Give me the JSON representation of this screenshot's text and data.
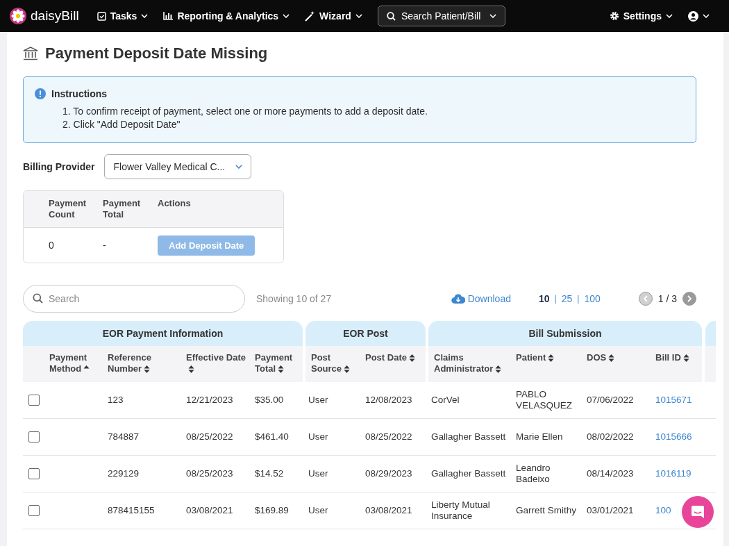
{
  "nav": {
    "brand": "daisyBill",
    "items": [
      {
        "label": "Tasks"
      },
      {
        "label": "Reporting & Analytics"
      },
      {
        "label": "Wizard"
      }
    ],
    "search": {
      "label": "Search Patient/Bill"
    },
    "settings": {
      "label": "Settings"
    }
  },
  "page": {
    "title": "Payment Deposit Date Missing"
  },
  "instructions": {
    "title": "Instructions",
    "steps": [
      "1. To confirm receipt of payment, select one or more payments to add a deposit date.",
      "2. Click \"Add Deposit Date\""
    ]
  },
  "billing_provider": {
    "label": "Billing Provider",
    "value": "Flower Valley Medical C..."
  },
  "summary": {
    "columns": [
      "Payment Count",
      "Payment Total",
      "Actions"
    ],
    "count": "0",
    "total": "-",
    "action": {
      "label": "Add Deposit Date",
      "disabled": true
    }
  },
  "toolbar": {
    "search": {
      "placeholder": "Search"
    },
    "showing": "Showing 10 of 27",
    "download": "Download",
    "page_sizes": [
      {
        "label": "10",
        "selected": true
      },
      {
        "label": "25",
        "selected": false
      },
      {
        "label": "100",
        "selected": false
      }
    ],
    "separators": [
      "|",
      "|"
    ],
    "page": "1 / 3",
    "prev_disabled": true,
    "next_disabled": false
  },
  "table": {
    "groups": [
      {
        "label": "EOR Payment Information"
      },
      {
        "label": "EOR Post"
      },
      {
        "label": "Bill Submission"
      }
    ],
    "columns": [
      {
        "label": "Payment Method",
        "sorted_ascending": true
      },
      {
        "label": "Reference Number",
        "sorted_ascending": false
      },
      {
        "label": "Effective Date",
        "sorted_ascending": false
      },
      {
        "label": "Payment Total",
        "sorted_ascending": false
      },
      {
        "label": "Post Source",
        "sorted_ascending": false
      },
      {
        "label": "Post Date",
        "sorted_ascending": false
      },
      {
        "label": "Claims Administrator",
        "sorted_ascending": false
      },
      {
        "label": "Patient",
        "sorted_ascending": false
      },
      {
        "label": "DOS",
        "sorted_ascending": false
      },
      {
        "label": "Bill ID",
        "sorted_ascending": false
      }
    ],
    "rows": [
      {
        "checked": false,
        "cells": [
          "",
          "123",
          "12/21/2023",
          "$35.00",
          "User",
          "12/08/2023",
          "CorVel",
          "PABLO VELASQUEZ",
          "07/06/2022",
          "1015671"
        ]
      },
      {
        "checked": false,
        "cells": [
          "",
          "784887",
          "08/25/2022",
          "$461.40",
          "User",
          "08/25/2022",
          "Gallagher Bassett",
          "Marie Ellen",
          "08/02/2022",
          "1015666"
        ]
      },
      {
        "checked": false,
        "cells": [
          "",
          "229129",
          "08/25/2023",
          "$14.52",
          "User",
          "08/29/2023",
          "Gallagher Bassett",
          "Leandro Badeixo",
          "08/14/2023",
          "1016119"
        ]
      },
      {
        "checked": false,
        "cells": [
          "",
          "878415155",
          "03/08/2021",
          "$169.89",
          "User",
          "03/08/2021",
          "Liberty Mutual Insurance",
          "Garrett Smithy",
          "03/01/2021",
          "100"
        ]
      }
    ]
  }
}
